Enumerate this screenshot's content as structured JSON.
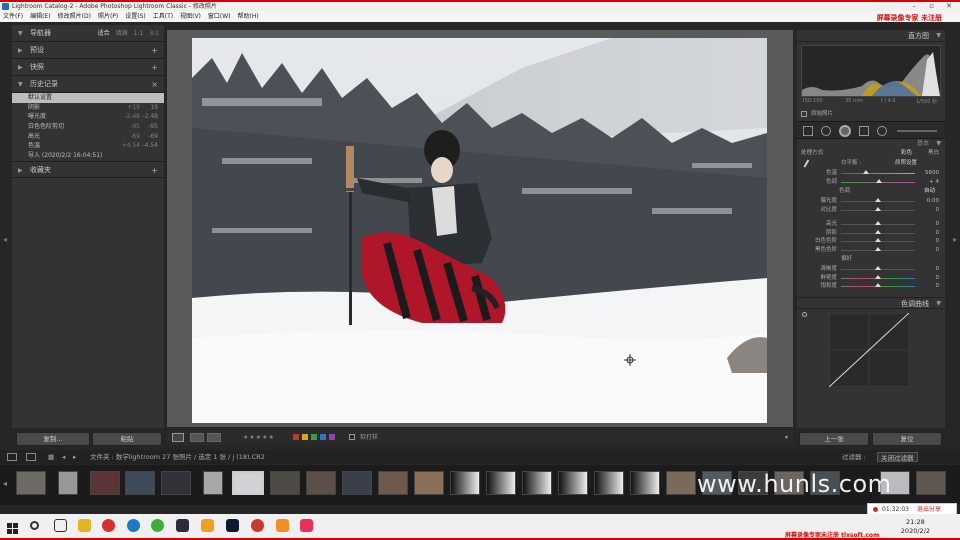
{
  "window": {
    "title": "Lightroom Catalog-2 - Adobe Photoshop Lightroom Classic - 修改照片",
    "recorder_label": "屏幕录像专家 未注册"
  },
  "menu": [
    "文件(F)",
    "编辑(E)",
    "修改照片(D)",
    "照片(P)",
    "设置(S)",
    "工具(T)",
    "视图(V)",
    "窗口(W)",
    "帮助(H)"
  ],
  "left_panel": {
    "navigator": {
      "label": "导航器",
      "options": [
        "适合",
        "填满",
        "1:1",
        "3:1"
      ]
    },
    "presets": "预设",
    "snapshots": "快照",
    "history": {
      "label": "历史记录",
      "items": [
        {
          "name": "默认设置",
          "a": "",
          "b": ""
        },
        {
          "name": "阴影",
          "a": "+19",
          "b": "19"
        },
        {
          "name": "曝光度",
          "a": "-2.48",
          "b": "-2.48"
        },
        {
          "name": "白色色阶剪切",
          "a": "-95",
          "b": "-95"
        },
        {
          "name": "高光",
          "a": "-69",
          "b": "-69"
        },
        {
          "name": "色温",
          "a": "+4.54",
          "b": "-4.54"
        },
        {
          "name": "导入 (2020/2/2 16:04:51)",
          "a": "",
          "b": ""
        }
      ]
    },
    "collections": "收藏夹",
    "buttons": {
      "copy": "复制...",
      "paste": "粘贴"
    }
  },
  "toolbar": {
    "softproof": "软打样"
  },
  "right_panel": {
    "histogram_label": "直方图",
    "histogram_info": [
      "ISO 100",
      "35 mm",
      "f / 4.0",
      "1/500 秒"
    ],
    "original_photo": "原始照片",
    "basic": {
      "label": "基本",
      "treatment": "处理方式:",
      "color": "彩色",
      "bw": "黑白",
      "wb_label": "白平衡 :",
      "wb_value": "原照设置",
      "temp": {
        "label": "色温",
        "value": "5600"
      },
      "tint": {
        "label": "色调",
        "value": "+ 4"
      },
      "tone_label": "色调",
      "auto": "自动",
      "tone_rows": [
        {
          "label": "曝光度",
          "value": "0.00"
        },
        {
          "label": "对比度",
          "value": "0"
        },
        {
          "label": "高光",
          "value": "0"
        },
        {
          "label": "阴影",
          "value": "0"
        },
        {
          "label": "白色色阶",
          "value": "0"
        },
        {
          "label": "黑色色阶",
          "value": "0"
        }
      ],
      "presence_label": "偏好",
      "presence_rows": [
        {
          "label": "清晰度",
          "value": "0"
        },
        {
          "label": "鲜艳度",
          "value": "0"
        },
        {
          "label": "饱和度",
          "value": "0"
        }
      ]
    },
    "tone_curve": "色调曲线",
    "buttons": {
      "previous": "上一张",
      "reset": "复位"
    }
  },
  "filmstrip": {
    "path": "文件夹 : 数学lightroom   27 张照片 / 选定 1 张 / j (18).CR2",
    "filter_label": "过滤器 :",
    "filter_value": "关闭过滤器"
  },
  "watermark": "www.hunls.com",
  "recorder": {
    "time": "01:32:03",
    "stop": "退出分享"
  },
  "taskbar": {
    "time": "21:28",
    "date": "2020/2/2",
    "footer": "屏幕录像专家未注册 tlxsoft.com"
  }
}
